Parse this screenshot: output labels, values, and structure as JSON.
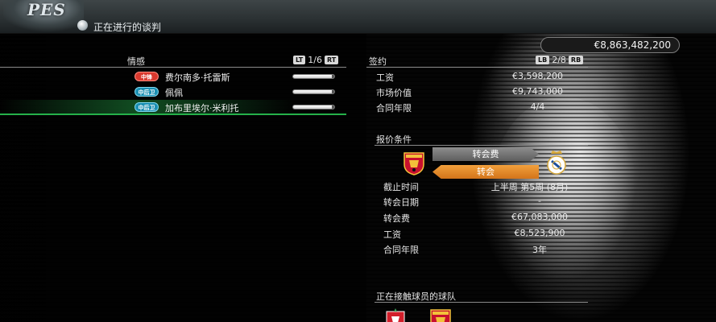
{
  "header": {
    "logo_text": "PES",
    "title": "正在进行的谈判"
  },
  "funds": "€8,863,482,200",
  "left_panel": {
    "title": "情感",
    "pager": {
      "left_button": "LT",
      "page": "1/6",
      "right_button": "RT"
    },
    "players": [
      {
        "position": "中锋",
        "position_type": "mid",
        "name": "费尔南多·托雷斯",
        "mood": 0.95,
        "selected": false
      },
      {
        "position": "中后卫",
        "position_type": "def",
        "name": "佩佩",
        "mood": 0.95,
        "selected": false
      },
      {
        "position": "中后卫",
        "position_type": "def",
        "name": "加布里埃尔·米利托",
        "mood": 0.95,
        "selected": true
      }
    ]
  },
  "contract": {
    "title": "签约",
    "pager": {
      "left_button": "LB",
      "page": "2/8",
      "right_button": "RB"
    },
    "rows": [
      {
        "label": "工资",
        "value": "€3,598,200"
      },
      {
        "label": "市场价值",
        "value": "€9,743,000"
      },
      {
        "label": "合同年限",
        "value": "4/4"
      }
    ]
  },
  "offer": {
    "title": "报价条件",
    "transfer_fee_label": "转会费",
    "transfer_label": "转会",
    "rows": [
      {
        "label": "截止时间",
        "value": "上半周 第5周 (8月)"
      },
      {
        "label": "转会日期",
        "value": "-"
      },
      {
        "label": "转会费",
        "value": "€67,083,000"
      },
      {
        "label": "工资",
        "value": "€8,523,900"
      },
      {
        "label": "合同年限",
        "value": "3年"
      }
    ]
  },
  "negotiating": {
    "title": "正在接触球员的球队"
  },
  "colors": {
    "accent_orange": "#e08a2a",
    "selected_green": "#25b14a",
    "midfield_badge": "#d9392e",
    "defender_badge": "#1b8fb2"
  }
}
